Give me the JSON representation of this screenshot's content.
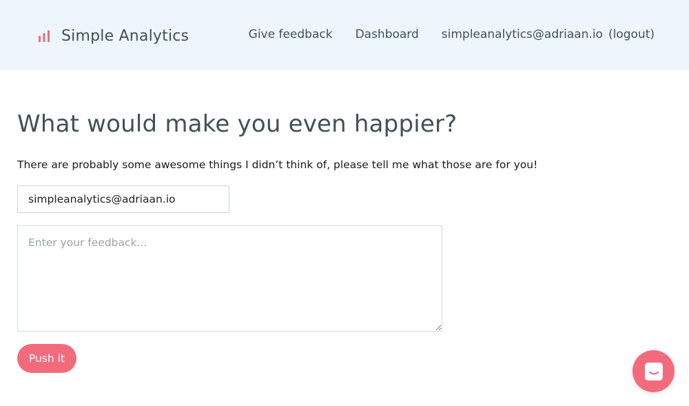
{
  "header": {
    "brand_name": "Simple Analytics",
    "brand_icon": "bar-chart-icon",
    "nav": {
      "give_feedback": "Give feedback",
      "dashboard": "Dashboard",
      "user_email": "simpleanalytics@adriaan.io",
      "logout": "(logout)"
    }
  },
  "main": {
    "title": "What would make you even happier?",
    "intro": "There are probably some awesome things I didn’t think of, please tell me what those are for you!",
    "email_value": "simpleanalytics@adriaan.io",
    "feedback_placeholder": "Enter your feedback...",
    "submit_label": "Push it"
  },
  "chat": {
    "icon": "chat-icon"
  },
  "colors": {
    "header_bg": "#eef6fd",
    "accent": "#f26b7d",
    "heading": "#415058"
  }
}
